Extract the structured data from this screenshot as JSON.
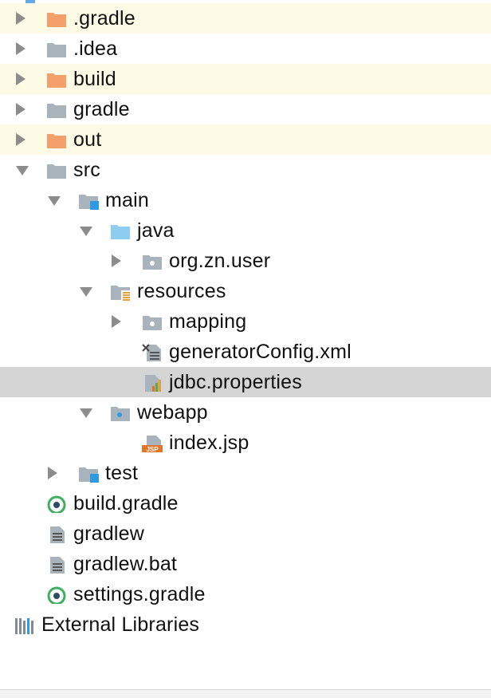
{
  "tree": {
    "items": [
      {
        "id": "gradle-dir",
        "label": ".gradle",
        "depth": 0,
        "arrow": "collapsed",
        "icon": "folder-orange",
        "state": "excluded"
      },
      {
        "id": "idea-dir",
        "label": ".idea",
        "depth": 0,
        "arrow": "collapsed",
        "icon": "folder-gray",
        "state": ""
      },
      {
        "id": "build-dir",
        "label": "build",
        "depth": 0,
        "arrow": "collapsed",
        "icon": "folder-orange",
        "state": "excluded"
      },
      {
        "id": "gradle-wrapper-dir",
        "label": "gradle",
        "depth": 0,
        "arrow": "collapsed",
        "icon": "folder-gray",
        "state": ""
      },
      {
        "id": "out-dir",
        "label": "out",
        "depth": 0,
        "arrow": "collapsed",
        "icon": "folder-orange",
        "state": "excluded"
      },
      {
        "id": "src-dir",
        "label": "src",
        "depth": 0,
        "arrow": "expanded",
        "icon": "folder-gray",
        "state": ""
      },
      {
        "id": "main-dir",
        "label": "main",
        "depth": 1,
        "arrow": "expanded",
        "icon": "folder-module",
        "state": ""
      },
      {
        "id": "java-dir",
        "label": "java",
        "depth": 2,
        "arrow": "expanded",
        "icon": "folder-source",
        "state": ""
      },
      {
        "id": "package-org-zn-user",
        "label": "org.zn.user",
        "depth": 3,
        "arrow": "collapsed",
        "icon": "package",
        "state": ""
      },
      {
        "id": "resources-dir",
        "label": "resources",
        "depth": 2,
        "arrow": "expanded",
        "icon": "folder-resources",
        "state": ""
      },
      {
        "id": "mapping-dir",
        "label": "mapping",
        "depth": 3,
        "arrow": "collapsed",
        "icon": "package",
        "state": ""
      },
      {
        "id": "generator-config-file",
        "label": "generatorConfig.xml",
        "depth": 3,
        "arrow": "none",
        "icon": "file-xml",
        "state": ""
      },
      {
        "id": "jdbc-properties-file",
        "label": "jdbc.properties",
        "depth": 3,
        "arrow": "none",
        "icon": "file-properties",
        "state": "selected"
      },
      {
        "id": "webapp-dir",
        "label": "webapp",
        "depth": 2,
        "arrow": "expanded",
        "icon": "folder-web",
        "state": ""
      },
      {
        "id": "index-jsp-file",
        "label": "index.jsp",
        "depth": 3,
        "arrow": "none",
        "icon": "file-jsp",
        "state": ""
      },
      {
        "id": "test-dir",
        "label": "test",
        "depth": 1,
        "arrow": "collapsed",
        "icon": "folder-module",
        "state": ""
      },
      {
        "id": "build-gradle-file",
        "label": "build.gradle",
        "depth": 0,
        "arrow": "none",
        "icon": "file-gradle",
        "state": "",
        "flush": true
      },
      {
        "id": "gradlew-file",
        "label": "gradlew",
        "depth": 0,
        "arrow": "none",
        "icon": "file-text",
        "state": "",
        "flush": true
      },
      {
        "id": "gradlew-bat-file",
        "label": "gradlew.bat",
        "depth": 0,
        "arrow": "none",
        "icon": "file-text",
        "state": "",
        "flush": true
      },
      {
        "id": "settings-gradle-file",
        "label": "settings.gradle",
        "depth": 0,
        "arrow": "none",
        "icon": "file-gradle",
        "state": "",
        "flush": true
      },
      {
        "id": "external-libraries",
        "label": "External Libraries",
        "depth": -1,
        "arrow": "none",
        "icon": "libraries",
        "state": "",
        "flush": true
      }
    ],
    "jsp_badge": "JSP",
    "colors": {
      "folder_orange": "#f4a06b",
      "folder_gray": "#a9b3bc",
      "folder_source": "#8dcdf0",
      "module_badge": "#2e9ae0",
      "excluded_bg": "#fdfbe5",
      "selected_bg": "#d5d5d5"
    }
  }
}
